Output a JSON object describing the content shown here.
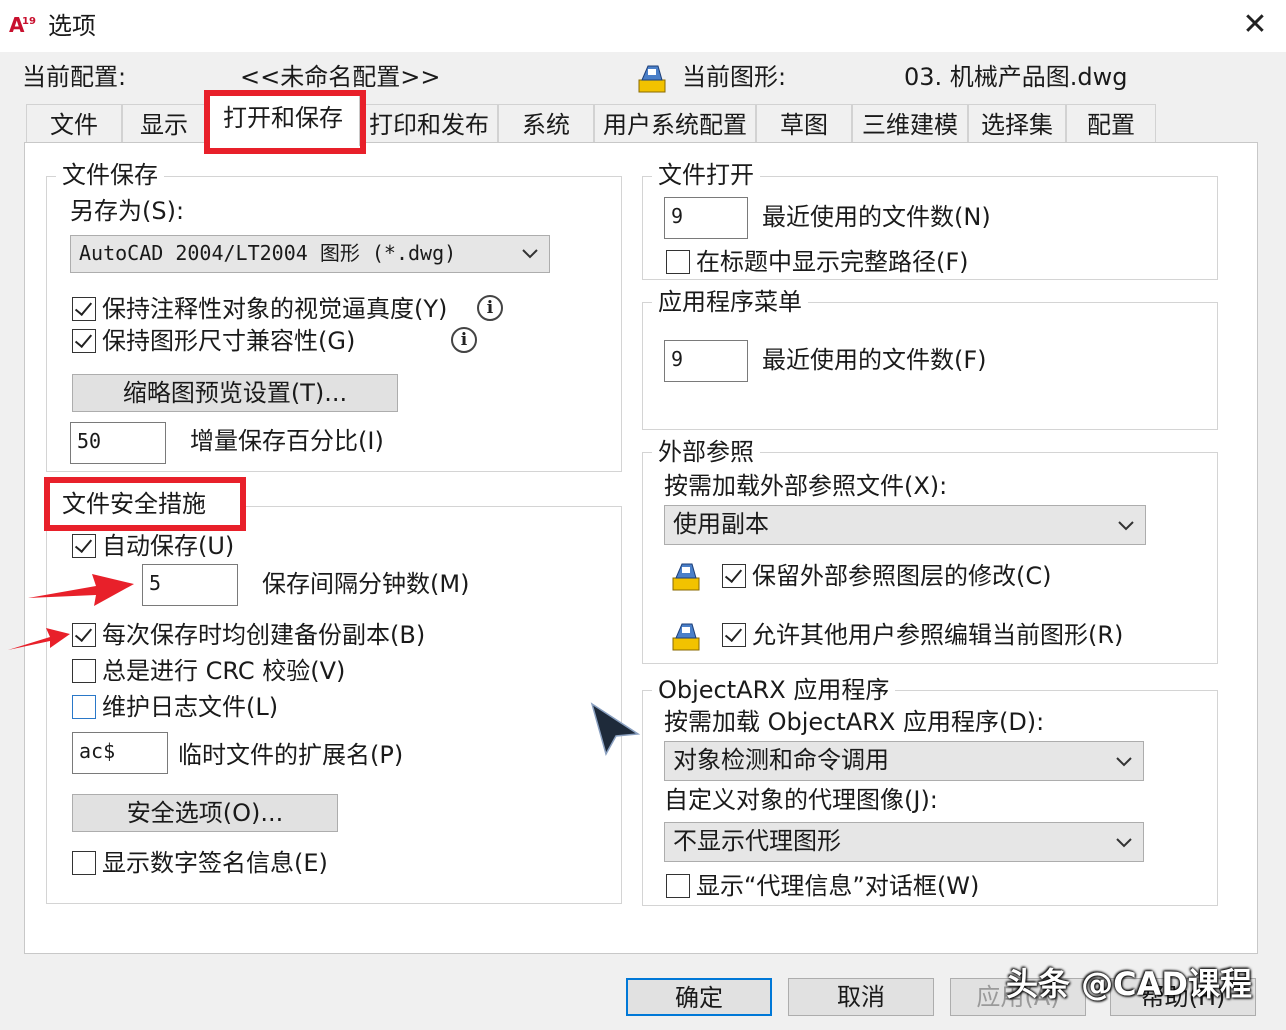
{
  "window": {
    "title": "选项",
    "close_label": "✕",
    "app_icon": "autocad-icon"
  },
  "header": {
    "current_profile_label": "当前配置:",
    "current_profile_value": "<<未命名配置>>",
    "current_drawing_label": "当前图形:",
    "current_drawing_value": "03. 机械产品图.dwg"
  },
  "tabs": [
    "文件",
    "显示",
    "打开和保存",
    "打印和发布",
    "系统",
    "用户系统配置",
    "草图",
    "三维建模",
    "选择集",
    "配置"
  ],
  "active_tab": "打开和保存",
  "file_save": {
    "title": "文件保存",
    "save_as_label": "另存为(S):",
    "save_as_value": "AutoCAD 2004/LT2004 图形 (*.dwg)",
    "keep_annotative_label": "保持注释性对象的视觉逼真度(Y)",
    "keep_annotative_checked": true,
    "keep_dimension_label": "保持图形尺寸兼容性(G)",
    "keep_dimension_checked": true,
    "thumbnail_button": "缩略图预览设置(T)...",
    "incremental_value": "50",
    "incremental_label": "增量保存百分比(I)"
  },
  "file_safety": {
    "title": "文件安全措施",
    "autosave_label": "自动保存(U)",
    "autosave_checked": true,
    "interval_value": "5",
    "interval_label": "保存间隔分钟数(M)",
    "backup_label": "每次保存时均创建备份副本(B)",
    "backup_checked": true,
    "crc_label": "总是进行 CRC 校验(V)",
    "crc_checked": false,
    "log_label": "维护日志文件(L)",
    "log_checked": false,
    "temp_ext_value": "ac$",
    "temp_ext_label": "临时文件的扩展名(P)",
    "security_button": "安全选项(O)...",
    "digital_sig_label": "显示数字签名信息(E)",
    "digital_sig_checked": false
  },
  "file_open": {
    "title": "文件打开",
    "recent_value": "9",
    "recent_label": "最近使用的文件数(N)",
    "full_path_label": "在标题中显示完整路径(F)",
    "full_path_checked": false
  },
  "app_menu": {
    "title": "应用程序菜单",
    "recent_value": "9",
    "recent_label": "最近使用的文件数(F)"
  },
  "xref": {
    "title": "外部参照",
    "demand_load_label": "按需加载外部参照文件(X):",
    "demand_load_value": "使用副本",
    "retain_layer_label": "保留外部参照图层的修改(C)",
    "retain_layer_checked": true,
    "allow_edit_label": "允许其他用户参照编辑当前图形(R)",
    "allow_edit_checked": true
  },
  "objectarx": {
    "title": "ObjectARX 应用程序",
    "demand_load_label": "按需加载 ObjectARX 应用程序(D):",
    "demand_load_value": "对象检测和命令调用",
    "proxy_images_label": "自定义对象的代理图像(J):",
    "proxy_images_value": "不显示代理图形",
    "proxy_info_label": "显示“代理信息”对话框(W)",
    "proxy_info_checked": false
  },
  "buttons": {
    "ok": "确定",
    "cancel": "取消",
    "apply": "应用(A)",
    "help": "帮助(H)"
  },
  "watermark": "头条 @CAD课程",
  "colors": {
    "highlight_red": "#e8202a",
    "default_button_border": "#0078d7"
  }
}
